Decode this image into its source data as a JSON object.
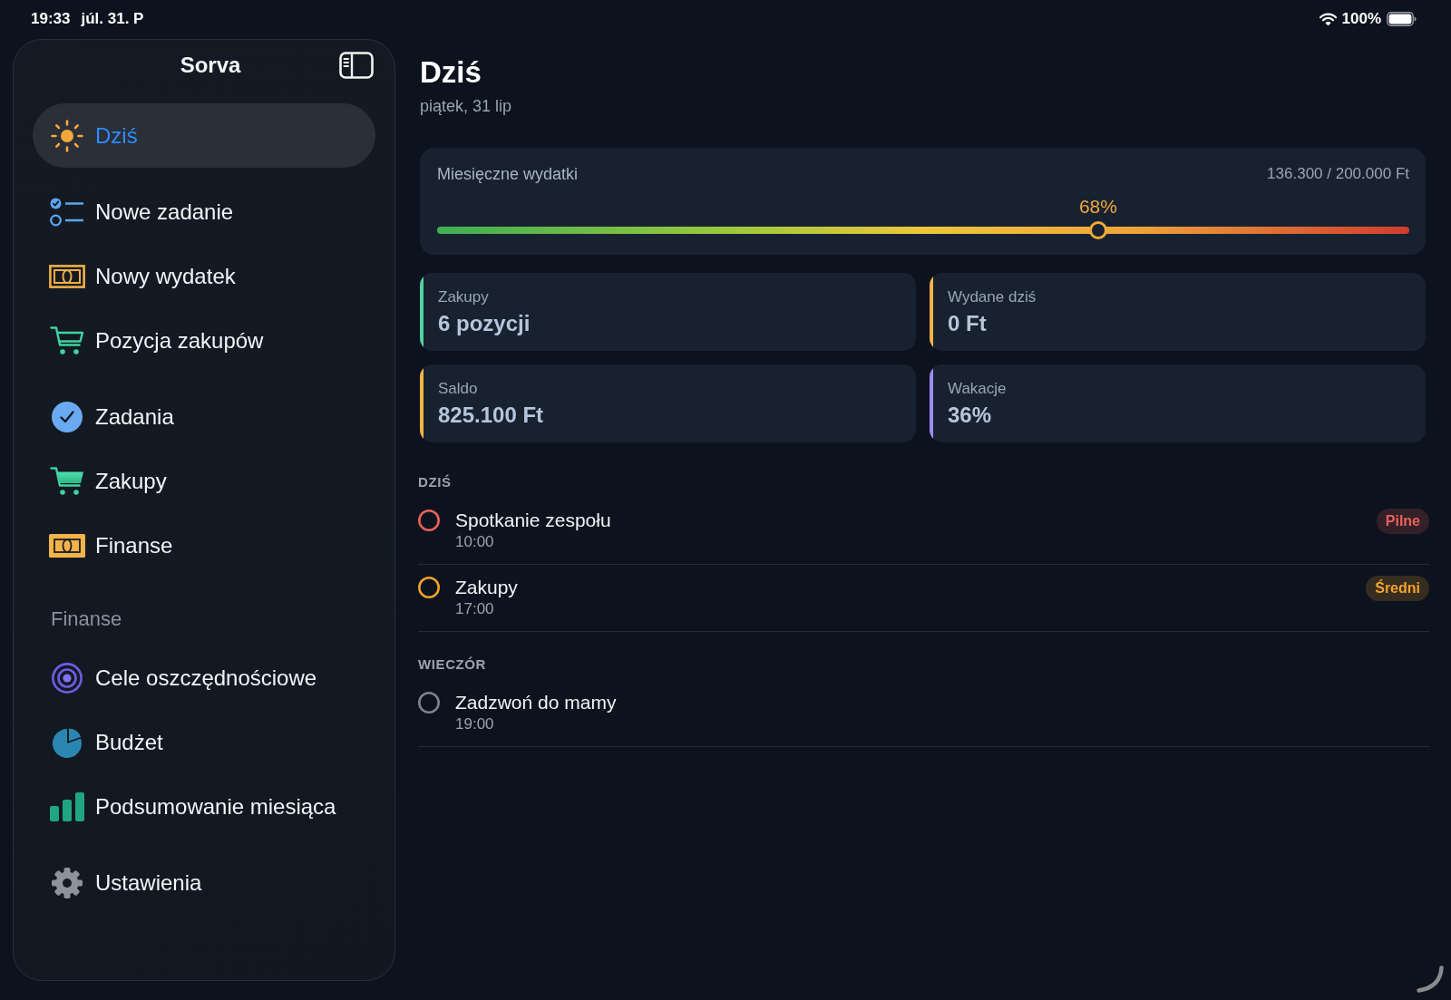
{
  "status_bar": {
    "time": "19:33",
    "date": "júl. 31. P",
    "battery": "100%"
  },
  "sidebar": {
    "title": "Sorva",
    "groups": [
      {
        "items": [
          {
            "label": "Dziś",
            "selected": true
          }
        ]
      },
      {
        "items": [
          {
            "label": "Nowe zadanie",
            "selected": false
          },
          {
            "label": "Nowy wydatek",
            "selected": false
          },
          {
            "label": "Pozycja zakupów",
            "selected": false
          }
        ]
      },
      {
        "items": [
          {
            "label": "Zadania",
            "selected": false
          },
          {
            "label": "Zakupy",
            "selected": false
          },
          {
            "label": "Finanse",
            "selected": false
          }
        ]
      },
      {
        "header": "Finanse",
        "items": [
          {
            "label": "Cele oszczędnościowe",
            "selected": false
          },
          {
            "label": "Budżet",
            "selected": false
          },
          {
            "label": "Podsumowanie miesiąca",
            "selected": false
          }
        ]
      },
      {
        "items": [
          {
            "label": "Ustawienia",
            "selected": false
          }
        ]
      }
    ]
  },
  "page": {
    "title": "Dziś",
    "subtitle": "piątek, 31 lip"
  },
  "budget": {
    "title": "Miesięczne wydatki",
    "amount": "136.300 / 200.000 Ft",
    "percent": "68%",
    "level": 0.68
  },
  "stats": [
    {
      "label": "Zakupy",
      "value": "6 pozycji",
      "color": "#4fd1a0"
    },
    {
      "label": "Wydane dziś",
      "value": "0 Ft",
      "color": "#f2b446"
    },
    {
      "label": "Saldo",
      "value": "825.100 Ft",
      "color": "#f2b446"
    },
    {
      "label": "Wakacje",
      "value": "36%",
      "color": "#9d8cf2"
    }
  ],
  "sections": [
    {
      "title": "DZIŚ",
      "tasks": [
        {
          "title": "Spotkanie zespołu",
          "time": "10:00",
          "color": "#e8615a",
          "checked": false,
          "badge": "Pilne"
        },
        {
          "title": "Zakupy",
          "time": "17:00",
          "color": "#f2a22e",
          "checked": false,
          "badge": "Średni"
        }
      ]
    },
    {
      "title": "WIECZÓR",
      "tasks": [
        {
          "title": "Zadzwoń do mamy",
          "time": "19:00",
          "color": "#7b838d",
          "checked": false
        }
      ]
    }
  ]
}
